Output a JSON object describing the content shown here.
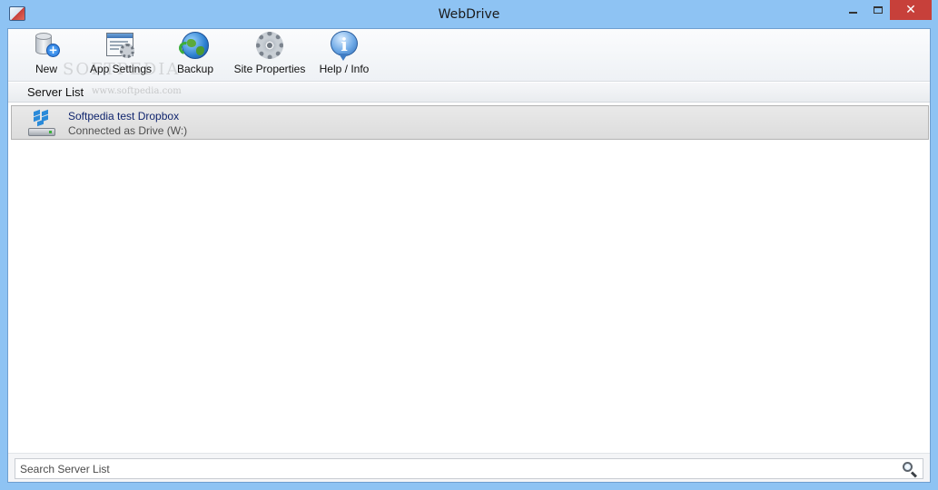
{
  "window": {
    "title": "WebDrive",
    "close_glyph": "✕"
  },
  "toolbar": {
    "items": [
      {
        "label": "New",
        "icon": "new-server-icon"
      },
      {
        "label": "App Settings",
        "icon": "app-settings-icon"
      },
      {
        "label": "Backup",
        "icon": "backup-globe-icon"
      },
      {
        "label": "Site Properties",
        "icon": "gear-icon"
      },
      {
        "label": "Help / Info",
        "icon": "info-icon"
      }
    ]
  },
  "watermark": {
    "text": "SOFTPEDIA",
    "url": "www.softpedia.com"
  },
  "server_list": {
    "header": "Server List",
    "items": [
      {
        "name": "Softpedia test Dropbox",
        "status": "Connected as Drive (W:)",
        "icon": "dropbox-drive-icon"
      }
    ]
  },
  "search": {
    "placeholder": "Search Server List",
    "value": ""
  },
  "colors": {
    "title_bar": "#8ec3f3",
    "close_button": "#c7403a",
    "server_name": "#10256e"
  }
}
